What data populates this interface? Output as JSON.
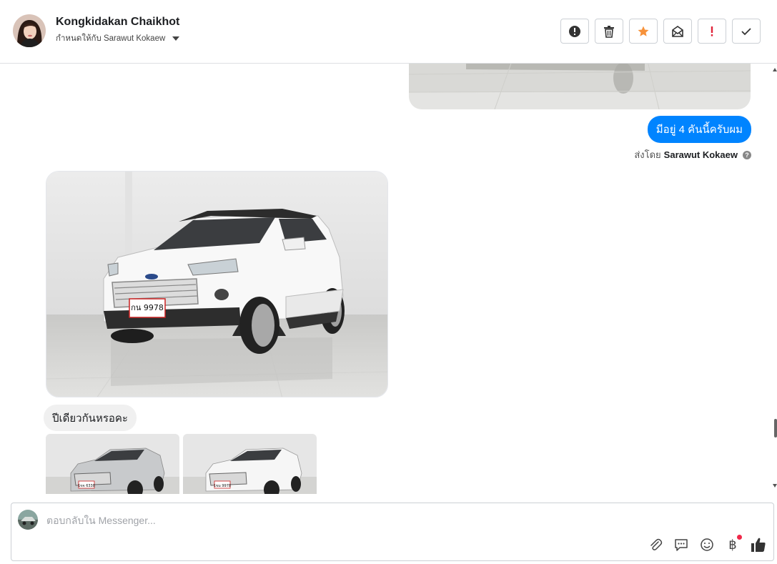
{
  "header": {
    "contact_name": "Kongkidakan Chaikhot",
    "assigned_to": "กำหนดให้กับ Sarawut Kokaew",
    "toolbar": [
      {
        "name": "spam-button",
        "icon": "alert-circle-icon"
      },
      {
        "name": "delete-button",
        "icon": "trash-icon"
      },
      {
        "name": "star-button",
        "icon": "star-icon"
      },
      {
        "name": "mark-unread-button",
        "icon": "envelope-icon"
      },
      {
        "name": "important-button",
        "icon": "exclamation-icon"
      },
      {
        "name": "done-button",
        "icon": "check-icon"
      }
    ]
  },
  "thread": {
    "outgoing_message": "มีอยู่ 4 คันนี้ครับผม",
    "sent_by_prefix": "ส่งโดย",
    "sent_by_name": "Sarawut Kokaew",
    "incoming_message": "ปีเดียวกันหรอคะ",
    "plate_text": "กน 9978",
    "thumb_plate_1": "1ขจ 6338",
    "thumb_plate_2": "1ขม 9978"
  },
  "composer": {
    "placeholder": "ตอบกลับใน Messenger...",
    "icons": [
      "paperclip-icon",
      "saved-reply-icon",
      "emoji-icon",
      "baht-icon",
      "thumbs-up-icon"
    ],
    "baht_symbol": "฿"
  },
  "colors": {
    "accent": "#0084ff",
    "star": "#f7923a",
    "important": "#e0243a",
    "incoming_bubble": "#f0f0f0"
  }
}
